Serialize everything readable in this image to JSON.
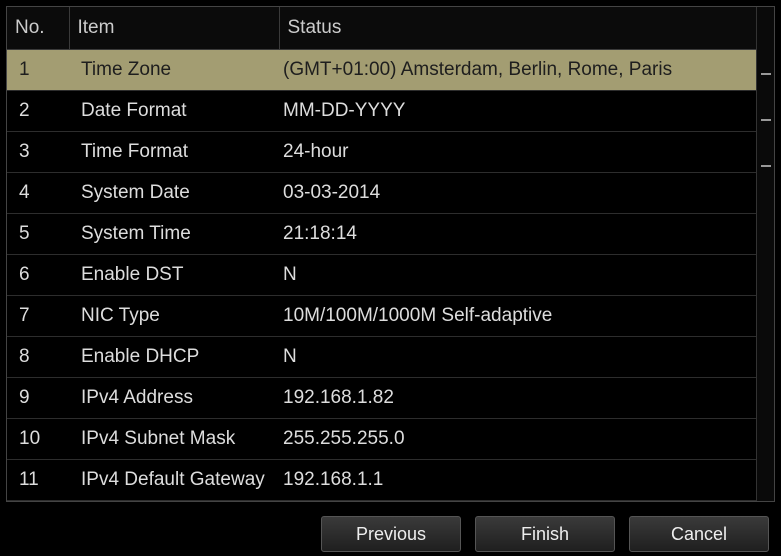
{
  "headers": {
    "no": "No.",
    "item": "Item",
    "status": "Status"
  },
  "rows": [
    {
      "no": "1",
      "item": "Time Zone",
      "status": "(GMT+01:00) Amsterdam, Berlin, Rome, Paris",
      "selected": true
    },
    {
      "no": "2",
      "item": "Date Format",
      "status": "MM-DD-YYYY"
    },
    {
      "no": "3",
      "item": "Time Format",
      "status": "24-hour"
    },
    {
      "no": "4",
      "item": "System Date",
      "status": "03-03-2014"
    },
    {
      "no": "5",
      "item": "System Time",
      "status": "21:18:14"
    },
    {
      "no": "6",
      "item": "Enable DST",
      "status": "N"
    },
    {
      "no": "7",
      "item": "NIC Type",
      "status": "10M/100M/1000M Self-adaptive"
    },
    {
      "no": "8",
      "item": "Enable DHCP",
      "status": "N"
    },
    {
      "no": "9",
      "item": "IPv4 Address",
      "status": "192.168.1.82"
    },
    {
      "no": "10",
      "item": "IPv4 Subnet Mask",
      "status": "255.255.255.0"
    },
    {
      "no": "11",
      "item": "IPv4 Default Gateway",
      "status": "192.168.1.1"
    }
  ],
  "buttons": {
    "previous": "Previous",
    "finish": "Finish",
    "cancel": "Cancel"
  }
}
